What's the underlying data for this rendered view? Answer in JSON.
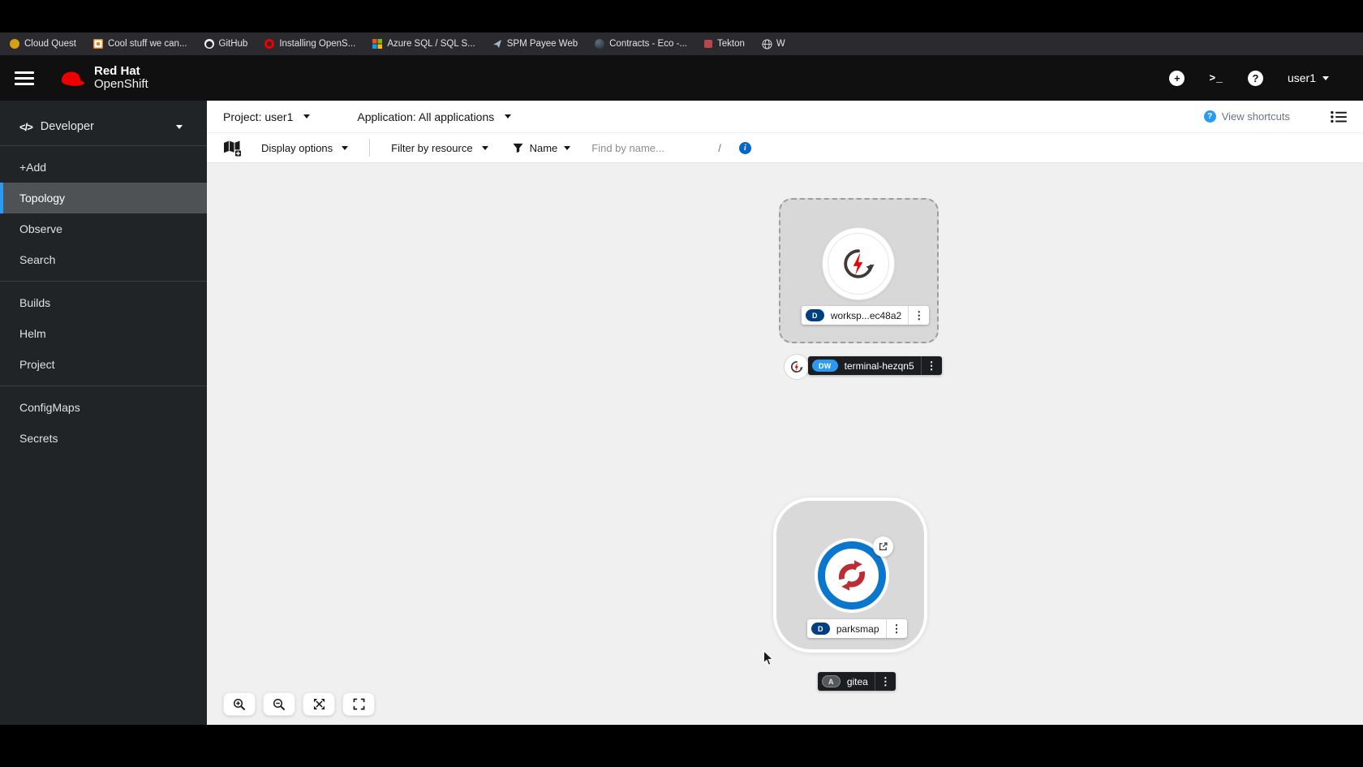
{
  "browser": {
    "bookmarks": [
      {
        "label": "Cloud Quest",
        "icon": "cloud-quest-favicon"
      },
      {
        "label": "Cool stuff we can...",
        "icon": "folder-favicon"
      },
      {
        "label": "GitHub",
        "icon": "github-favicon"
      },
      {
        "label": "Installing OpenS...",
        "icon": "openshift-favicon"
      },
      {
        "label": "Azure SQL / SQL S...",
        "icon": "microsoft-favicon"
      },
      {
        "label": "SPM Payee Web",
        "icon": "spm-favicon"
      },
      {
        "label": "Contracts - Eco -...",
        "icon": "contracts-favicon"
      },
      {
        "label": "Tekton",
        "icon": "tekton-favicon"
      },
      {
        "label": "W",
        "icon": "globe-favicon"
      }
    ]
  },
  "masthead": {
    "brand_top": "Red Hat",
    "brand_bottom": "OpenShift",
    "username": "user1"
  },
  "sidebar": {
    "perspective": "Developer",
    "items": [
      {
        "label": "+Add"
      },
      {
        "label": "Topology",
        "selected": true
      },
      {
        "label": "Observe"
      },
      {
        "label": "Search"
      },
      {
        "label": "Builds"
      },
      {
        "label": "Helm"
      },
      {
        "label": "Project"
      },
      {
        "label": "ConfigMaps"
      },
      {
        "label": "Secrets"
      }
    ]
  },
  "context_bar": {
    "project": "Project: user1",
    "application": "Application: All applications",
    "view_shortcuts": "View shortcuts"
  },
  "filter_bar": {
    "display_options": "Display options",
    "filter_by_resource": "Filter by resource",
    "name_filter": "Name",
    "find_placeholder": "Find by name...",
    "shortcut_key": "/"
  },
  "topology": {
    "workspace_group": {
      "badge": "D",
      "label": "worksp...ec48a2"
    },
    "terminal_node": {
      "badge": "DW",
      "label": "terminal-hezqn5"
    },
    "parksmap_node": {
      "badge": "D",
      "label": "parksmap"
    },
    "gitea_node": {
      "badge": "A",
      "label": "gitea"
    }
  },
  "icons": {
    "kebab": "⋮",
    "plus": "+",
    "help": "?",
    "terminal": ">_",
    "developer_perspective": "</>",
    "info": "i",
    "question": "?"
  },
  "colors": {
    "accent_blue": "#2b9af3",
    "deployment_badge_navy": "#004080",
    "devworkspace_badge_blue": "#2b9af3",
    "parksmap_ring_blue": "#0a76cc",
    "redhat_red": "#ee0000",
    "sidebar_bg": "#212427",
    "canvas_bg": "#f0f0f1"
  }
}
